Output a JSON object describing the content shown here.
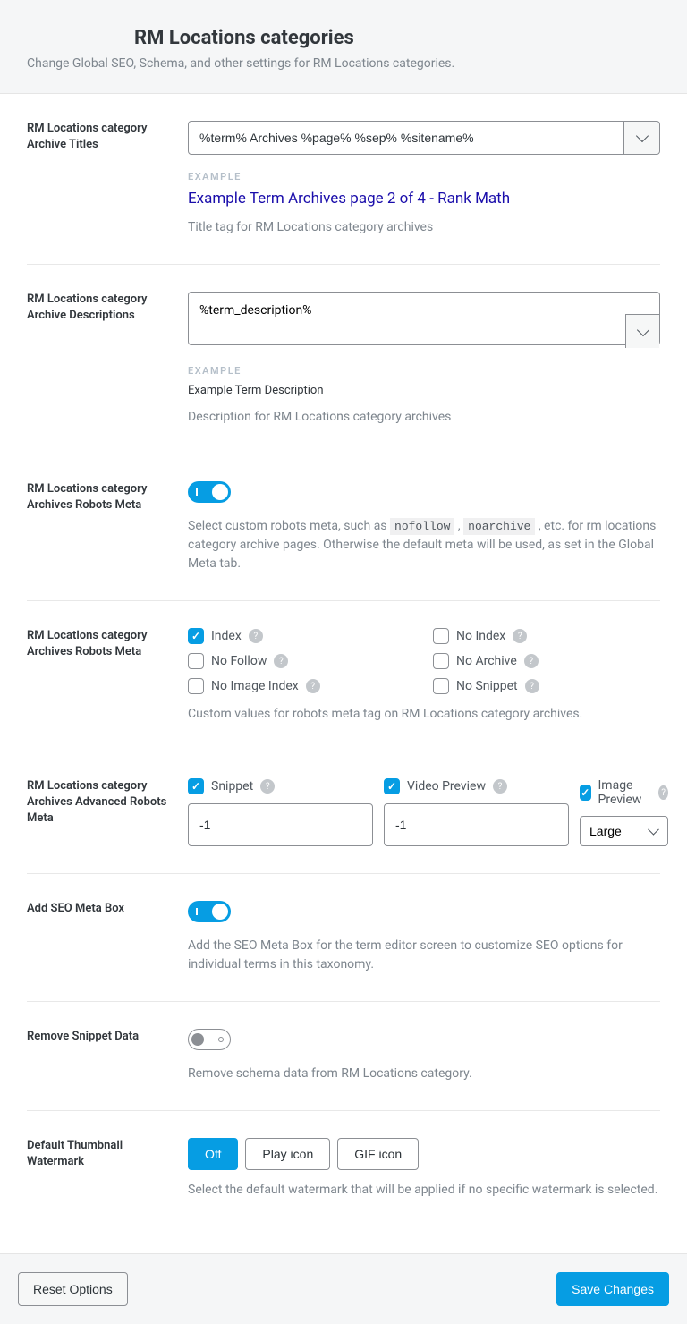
{
  "header": {
    "title": "RM Locations categories",
    "subtitle": "Change Global SEO, Schema, and other settings for RM Locations categories."
  },
  "titles": {
    "label": "RM Locations category Archive Titles",
    "value": "%term% Archives %page% %sep% %sitename%",
    "example_label": "EXAMPLE",
    "example": "Example Term Archives page 2 of 4 - Rank Math",
    "help": "Title tag for RM Locations category archives"
  },
  "descriptions": {
    "label": "RM Locations category Archive Descriptions",
    "value": "%term_description%",
    "example_label": "EXAMPLE",
    "example": "Example Term Description",
    "help": "Description for RM Locations category archives"
  },
  "robots_toggle": {
    "label": "RM Locations category Archives Robots Meta",
    "help_pre": "Select custom robots meta, such as ",
    "code1": "nofollow",
    "sep": " , ",
    "code2": "noarchive",
    "help_post": " , etc. for rm locations category archive pages. Otherwise the default meta will be used, as set in the Global Meta tab."
  },
  "robots_checks": {
    "label": "RM Locations category Archives Robots Meta",
    "options": {
      "index": "Index",
      "noindex": "No Index",
      "nofollow": "No Follow",
      "noarchive": "No Archive",
      "noimageindex": "No Image Index",
      "nosnippet": "No Snippet"
    },
    "help": "Custom values for robots meta tag on RM Locations category archives."
  },
  "advanced": {
    "label": "RM Locations category Archives Advanced Robots Meta",
    "snippet": {
      "label": "Snippet",
      "value": "-1"
    },
    "video": {
      "label": "Video Preview",
      "value": "-1"
    },
    "image": {
      "label": "Image Preview",
      "value": "Large"
    }
  },
  "seo_box": {
    "label": "Add SEO Meta Box",
    "help": "Add the SEO Meta Box for the term editor screen to customize SEO options for individual terms in this taxonomy."
  },
  "snippet_data": {
    "label": "Remove Snippet Data",
    "help": "Remove schema data from RM Locations category."
  },
  "watermark": {
    "label": "Default Thumbnail Watermark",
    "off": "Off",
    "play": "Play icon",
    "gif": "GIF icon",
    "help": "Select the default watermark that will be applied if no specific watermark is selected."
  },
  "footer": {
    "reset": "Reset Options",
    "save": "Save Changes"
  }
}
